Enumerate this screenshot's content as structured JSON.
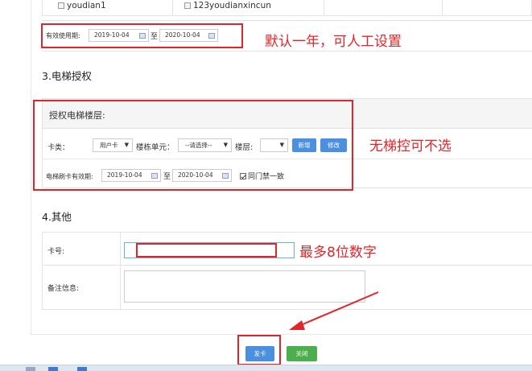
{
  "top_row": {
    "cell1": "youdian1",
    "cell2": "123youdianxincun"
  },
  "validity": {
    "label": "有效使用期:",
    "start": "2019-10-04",
    "to": "至",
    "end": "2020-10-04",
    "annotation": "默认一年，可人工设置"
  },
  "elevator": {
    "section_title": "3.电梯授权",
    "panel_title": "授权电梯楼层:",
    "card_type_label": "卡类：",
    "card_type_value": "用户卡",
    "unit_label": "楼栋单元：",
    "unit_value": "--请选择--",
    "floor_label": "楼层:",
    "floor_value": "",
    "add_button": "新增",
    "edit_button": "修改",
    "annotation": "无梯控可不选",
    "period_label": "电梯刷卡有效期:",
    "period_start": "2019-10-04",
    "period_to": "至",
    "period_end": "2020-10-04",
    "same_door_label": "同门禁一致"
  },
  "other": {
    "section_title": "4.其他",
    "card_no_label": "卡号:",
    "card_no_value": "",
    "card_annotation": "最多8位数字",
    "remark_label": "备注信息:",
    "remark_value": ""
  },
  "actions": {
    "issue_button": "发卡",
    "close_button": "关闭"
  },
  "colors": {
    "annotation_red": "#e0262a",
    "primary_blue": "#4a8fe0",
    "success_green": "#4cae4c"
  }
}
